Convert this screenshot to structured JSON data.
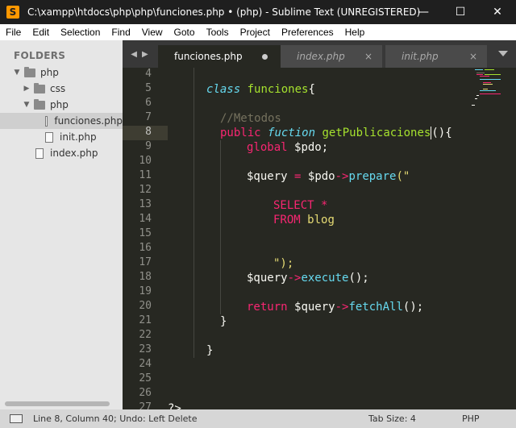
{
  "window": {
    "title": "C:\\xampp\\htdocs\\php\\php\\funciones.php • (php) - Sublime Text (UNREGISTERED)",
    "app_icon_letter": "S",
    "minimize": "—",
    "maximize": "☐",
    "close": "✕"
  },
  "menu": [
    "File",
    "Edit",
    "Selection",
    "Find",
    "View",
    "Goto",
    "Tools",
    "Project",
    "Preferences",
    "Help"
  ],
  "sidebar": {
    "header": "FOLDERS",
    "items": [
      {
        "label": "php",
        "type": "folder",
        "expanded": true
      },
      {
        "label": "css",
        "type": "folder",
        "expanded": false
      },
      {
        "label": "php",
        "type": "folder",
        "expanded": true
      },
      {
        "label": "funciones.php",
        "type": "file",
        "selected": true
      },
      {
        "label": "init.php",
        "type": "file"
      },
      {
        "label": "index.php",
        "type": "file"
      }
    ]
  },
  "tabs": [
    {
      "label": "funciones.php",
      "active": true,
      "dirty": true
    },
    {
      "label": "index.php",
      "active": false,
      "close": "×"
    },
    {
      "label": "init.php",
      "active": false,
      "close": "×"
    }
  ],
  "tab_nav": {
    "left": "◀",
    "right": "▶"
  },
  "editor": {
    "line_numbers": [
      "4",
      "5",
      "6",
      "7",
      "8",
      "9",
      "10",
      "11",
      "12",
      "13",
      "14",
      "15",
      "16",
      "17",
      "18",
      "19",
      "20",
      "21",
      "22",
      "23",
      "24",
      "25",
      "26",
      "27"
    ],
    "current_line": "8",
    "lines": {
      "l5": {
        "k": "class",
        "n": "funciones",
        "p": "{"
      },
      "l7": {
        "c": "//Metodos"
      },
      "l8": {
        "k1": "public",
        "k2": "fuction",
        "n": "getPublicaciones",
        "p1": "(",
        "p2": ")",
        "p3": "{"
      },
      "l9": {
        "k": "global",
        "v": "$pdo;"
      },
      "l11": {
        "v1": "$query",
        "op": "=",
        "v2": "$pdo",
        "ar": "->",
        "f": "prepare",
        "s": "(\""
      },
      "l13": {
        "s": "SELECT *"
      },
      "l14": {
        "s1": "FROM",
        "s2": "blog"
      },
      "l17": {
        "s": "\");"
      },
      "l18": {
        "v": "$query",
        "ar": "->",
        "f": "execute",
        "p": "();"
      },
      "l20": {
        "k": "return",
        "v": "$query",
        "ar": "->",
        "f": "fetchAll",
        "p": "();"
      },
      "l21": {
        "p": "}"
      },
      "l23": {
        "p": "}"
      },
      "l27": {
        "p": "?>"
      }
    }
  },
  "status": {
    "position": "Line 8, Column 40; Undo: Left Delete",
    "tab_size": "Tab Size: 4",
    "syntax": "PHP"
  },
  "colors": {
    "keyword": "#f92672",
    "storage": "#66d9ef",
    "entity": "#a6e22e",
    "string": "#e6db74",
    "comment": "#75715e",
    "background": "#272822"
  }
}
